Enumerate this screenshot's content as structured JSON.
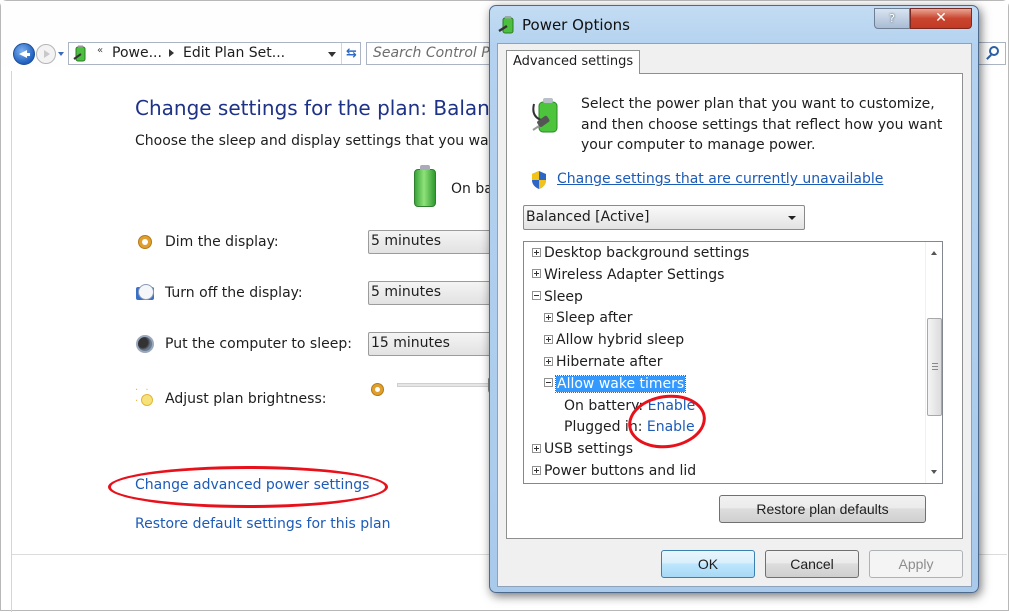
{
  "control_panel": {
    "address_bar": {
      "overflow_chevron": "«",
      "crumbs": [
        "Powe...",
        "Edit Plan Set..."
      ],
      "refresh_icon": "refresh-icon"
    },
    "search": {
      "placeholder": "Search Control Panel"
    },
    "title": "Change settings for the plan: Balanced",
    "subtitle": "Choose the sleep and display settings that you want",
    "column_header": "On battery",
    "settings": [
      {
        "label": "Dim the display:",
        "value": "5 minutes",
        "icon": "dim-display-icon"
      },
      {
        "label": "Turn off the display:",
        "value": "5 minutes",
        "icon": "display-off-icon"
      },
      {
        "label": "Put the computer to sleep:",
        "value": "15 minutes",
        "icon": "sleep-icon"
      },
      {
        "label": "Adjust plan brightness:",
        "icon": "brightness-icon",
        "brightness_fraction": 0.95
      }
    ],
    "links": {
      "advanced": "Change advanced power settings",
      "restore": "Restore default settings for this plan"
    }
  },
  "dialog": {
    "title": "Power Options",
    "help_label": "?",
    "close_label": "✕",
    "tab": "Advanced settings",
    "intro": "Select the power plan that you want to customize, and then choose settings that reflect how you want your computer to manage power.",
    "unavailable_link": "Change settings that are currently unavailable",
    "plan_selected": "Balanced [Active]",
    "tree": [
      {
        "label": "Desktop background settings",
        "level": 0,
        "state": "collapsed"
      },
      {
        "label": "Wireless Adapter Settings",
        "level": 0,
        "state": "collapsed"
      },
      {
        "label": "Sleep",
        "level": 0,
        "state": "expanded"
      },
      {
        "label": "Sleep after",
        "level": 1,
        "state": "collapsed"
      },
      {
        "label": "Allow hybrid sleep",
        "level": 1,
        "state": "collapsed"
      },
      {
        "label": "Hibernate after",
        "level": 1,
        "state": "collapsed"
      },
      {
        "label": "Allow wake timers",
        "level": 1,
        "state": "expanded",
        "selected": true
      },
      {
        "label": "On battery:",
        "value": "Enable",
        "level": 2
      },
      {
        "label": "Plugged in:",
        "value": "Enable",
        "level": 2
      },
      {
        "label": "USB settings",
        "level": 0,
        "state": "collapsed"
      },
      {
        "label": "Power buttons and lid",
        "level": 0,
        "state": "collapsed"
      }
    ],
    "buttons": {
      "restore": "Restore plan defaults",
      "ok": "OK",
      "cancel": "Cancel",
      "apply": "Apply"
    }
  },
  "annotations": {
    "highlight_color": "#e8101a"
  }
}
